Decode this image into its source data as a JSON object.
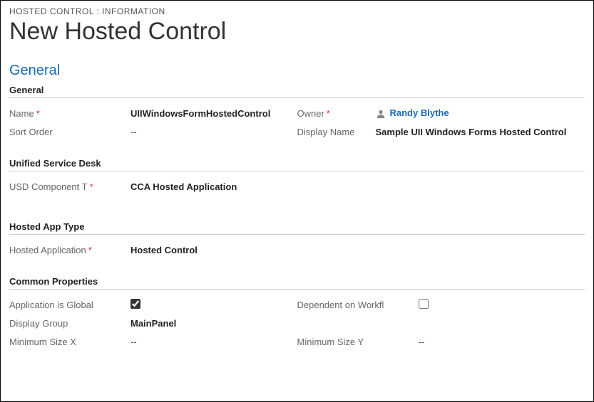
{
  "header": {
    "breadcrumb": "HOSTED CONTROL : INFORMATION",
    "title": "New Hosted Control"
  },
  "section_tab": "General",
  "sections": {
    "general": {
      "heading": "General",
      "name": {
        "label": "Name",
        "value": "UIIWindowsFormHostedControl"
      },
      "owner": {
        "label": "Owner",
        "value": "Randy Blythe"
      },
      "sort_order": {
        "label": "Sort Order",
        "value": "--"
      },
      "display_name": {
        "label": "Display Name",
        "value": "Sample UII Windows Forms Hosted Control"
      }
    },
    "usd": {
      "heading": "Unified Service Desk",
      "component_type": {
        "label": "USD Component T",
        "value": "CCA Hosted Application"
      }
    },
    "hosted_app_type": {
      "heading": "Hosted App Type",
      "hosted_application": {
        "label": "Hosted Application",
        "value": "Hosted Control"
      }
    },
    "common": {
      "heading": "Common Properties",
      "app_is_global": {
        "label": "Application is Global",
        "checked": true
      },
      "dependent_on_workflow": {
        "label": "Dependent on Workfl",
        "checked": false
      },
      "display_group": {
        "label": "Display Group",
        "value": "MainPanel"
      },
      "min_size_x": {
        "label": "Minimum Size X",
        "value": "--"
      },
      "min_size_y": {
        "label": "Minimum Size Y",
        "value": "--"
      }
    }
  }
}
